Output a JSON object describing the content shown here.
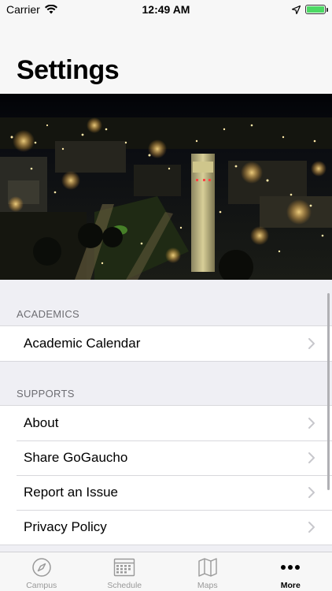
{
  "status_bar": {
    "carrier": "Carrier",
    "time": "12:49 AM",
    "battery_level": 1.0,
    "battery_color": "#4cd964"
  },
  "header": {
    "title": "Settings"
  },
  "hero": {
    "icon": "night-campus-photo"
  },
  "sections": {
    "academics": {
      "header": "ACADEMICS",
      "items": [
        {
          "label": "Academic Calendar",
          "icon": "chevron-right-icon"
        }
      ]
    },
    "supports": {
      "header": "SUPPORTS",
      "items": [
        {
          "label": "About",
          "icon": "chevron-right-icon"
        },
        {
          "label": "Share GoGaucho",
          "icon": "chevron-right-icon"
        },
        {
          "label": "Report an Issue",
          "icon": "chevron-right-icon"
        },
        {
          "label": "Privacy Policy",
          "icon": "chevron-right-icon"
        }
      ]
    }
  },
  "tab_bar": {
    "tabs": [
      {
        "label": "Campus",
        "icon": "compass-icon",
        "active": false
      },
      {
        "label": "Schedule",
        "icon": "calendar-icon",
        "active": false
      },
      {
        "label": "Maps",
        "icon": "map-icon",
        "active": false
      },
      {
        "label": "More",
        "icon": "more-dots-icon",
        "active": true
      }
    ],
    "active_color": "#000000",
    "inactive_color": "#999999"
  }
}
